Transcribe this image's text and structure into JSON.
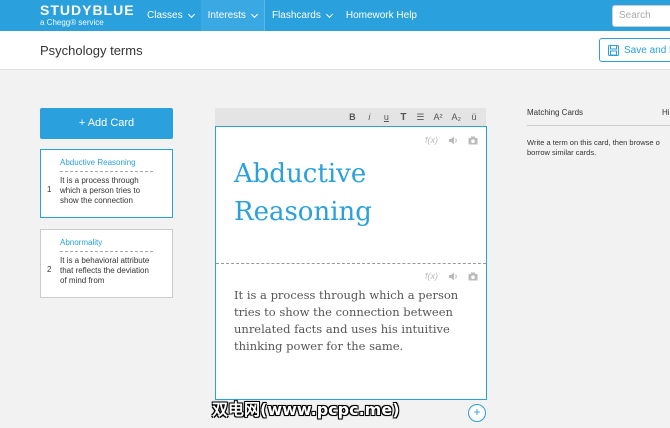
{
  "brand": {
    "name": "STUDYBLUE",
    "tagline": "a Chegg® service"
  },
  "nav": {
    "items": [
      {
        "label": "Classes",
        "has_menu": true
      },
      {
        "label": "Interests",
        "has_menu": true
      },
      {
        "label": "Flashcards",
        "has_menu": true
      },
      {
        "label": "Homework Help",
        "has_menu": false
      }
    ],
    "search_placeholder": "Search"
  },
  "page": {
    "title": "Psychology terms",
    "save_label": "Save and Ex"
  },
  "sidebar": {
    "add_card_label": "+ Add Card",
    "cards": [
      {
        "number": "1",
        "term": "Abductive Reasoning",
        "definition": "It is a process through which a person tries to show the connection",
        "selected": true
      },
      {
        "number": "2",
        "term": "Abnormality",
        "definition": "It is a behavioral attribute that reflects the deviation of mind from",
        "selected": false
      }
    ]
  },
  "toolbar": {
    "bold": "B",
    "italic": "i",
    "underline": "u",
    "text": "T",
    "list": "☰",
    "superscript": "A²",
    "subscript": "A₂",
    "umlaut": "ü"
  },
  "editor": {
    "term": "Abductive Reasoning",
    "definition": "It is a process through which a person tries to show the connection between unrelated facts and uses his intuitive thinking power for the same.",
    "formula_label": "f(x)"
  },
  "matching": {
    "title": "Matching Cards",
    "second_tab": "Hi",
    "hint": "Write a term on this card, then browse o borrow similar cards."
  },
  "watermark": "双电网(www.pcpc.me)",
  "colors": {
    "accent": "#2aa0dd"
  }
}
